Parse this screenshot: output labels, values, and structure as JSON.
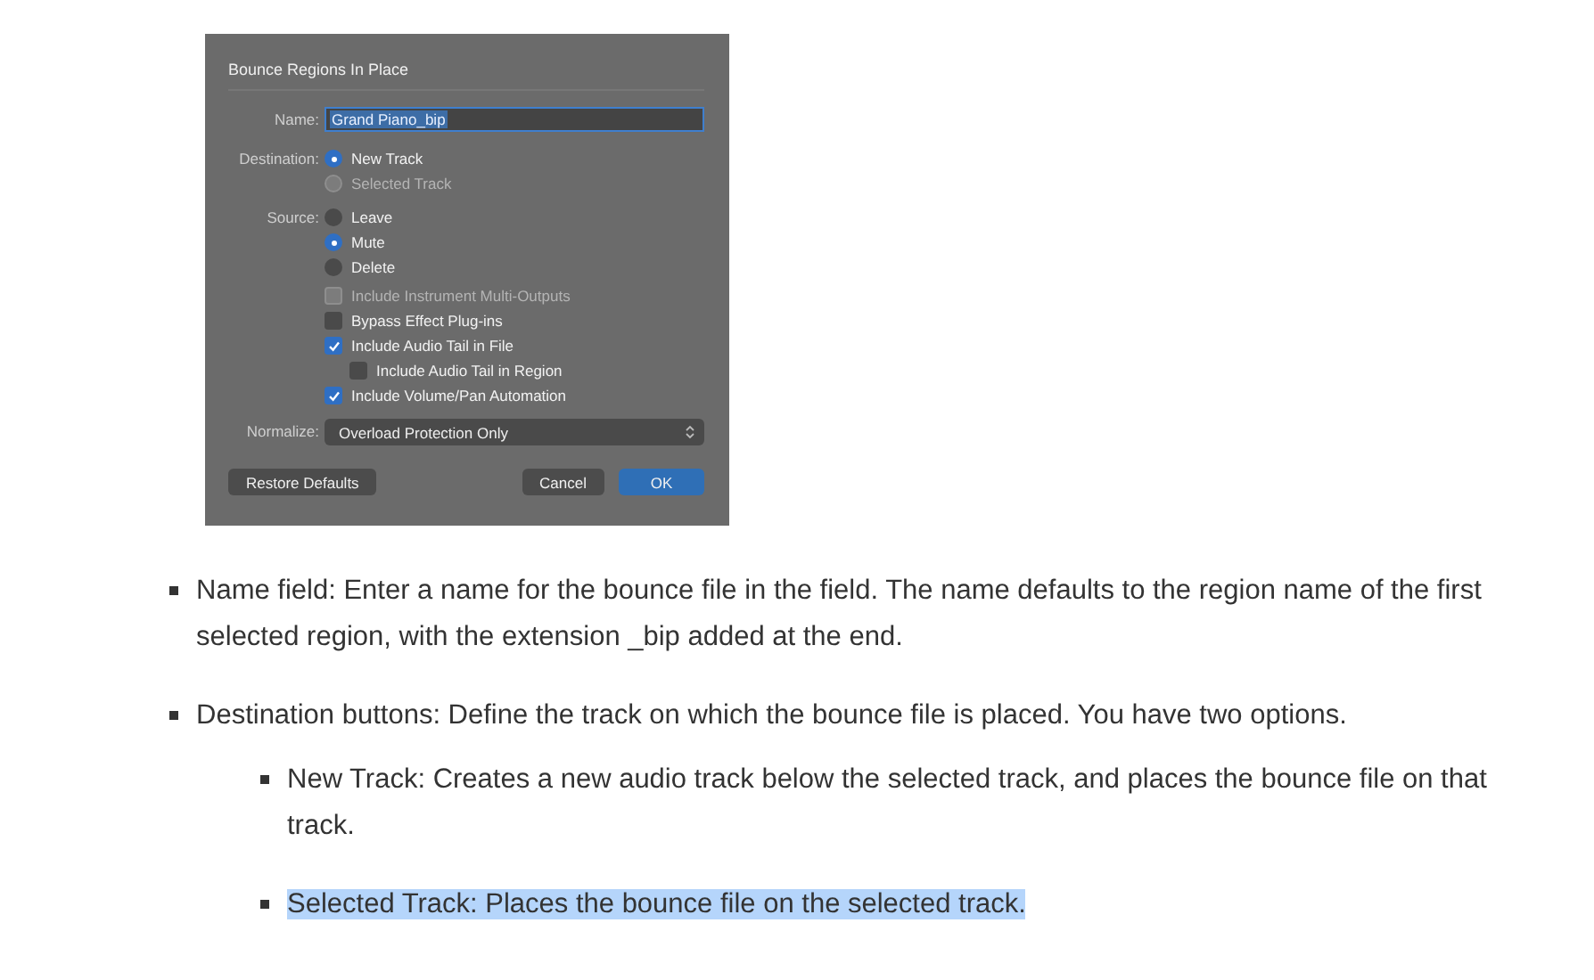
{
  "dialog": {
    "title": "Bounce Regions In Place",
    "name_field": {
      "label": "Name:",
      "value": "Grand Piano_bip",
      "text_selected": true
    },
    "destination": {
      "label": "Destination:",
      "options": [
        {
          "label": "New Track",
          "selected": true,
          "disabled": false
        },
        {
          "label": "Selected Track",
          "selected": false,
          "disabled": true
        }
      ]
    },
    "source": {
      "label": "Source:",
      "options": [
        {
          "label": "Leave",
          "selected": false,
          "disabled": false
        },
        {
          "label": "Mute",
          "selected": true,
          "disabled": false
        },
        {
          "label": "Delete",
          "selected": false,
          "disabled": false
        }
      ]
    },
    "checkboxes": [
      {
        "label": "Include Instrument Multi-Outputs",
        "checked": false,
        "disabled": true
      },
      {
        "label": "Bypass Effect Plug-ins",
        "checked": false,
        "disabled": false
      },
      {
        "label": "Include Audio Tail in File",
        "checked": true,
        "disabled": false,
        "children": [
          {
            "label": "Include Audio Tail in Region",
            "checked": false,
            "disabled": false
          }
        ]
      },
      {
        "label": "Include Volume/Pan Automation",
        "checked": true,
        "disabled": false
      }
    ],
    "normalize": {
      "label": "Normalize:",
      "value": "Overload Protection Only"
    },
    "buttons": [
      {
        "label": "Restore Defaults",
        "kind": "secondary"
      },
      {
        "label": "Cancel",
        "kind": "secondary"
      },
      {
        "label": "OK",
        "kind": "default"
      }
    ]
  },
  "bullets": [
    {
      "text": "Name field: Enter a name for the bounce file in the field. The name defaults to the region name of the first selected region, with the extension _bip added at the end.",
      "highlighted": false
    },
    {
      "text": "Destination buttons: Define the track on which the bounce file is placed. You have two options.",
      "highlighted": false,
      "children": [
        {
          "text": "New Track: Creates a new audio track below the selected track, and places the bounce file on that track.",
          "highlighted": false
        },
        {
          "text": "Selected Track: Places the bounce file on the selected track.",
          "highlighted": true
        }
      ]
    }
  ]
}
